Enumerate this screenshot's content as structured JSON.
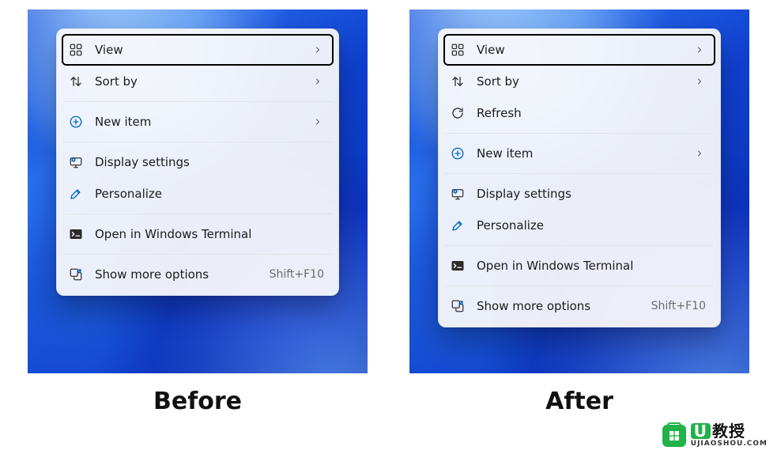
{
  "captions": {
    "before": "Before",
    "after": "After"
  },
  "menu_before": {
    "groups": [
      [
        {
          "id": "view",
          "label": "View",
          "icon": "grid-icon",
          "submenu": true,
          "highlight": true
        },
        {
          "id": "sortby",
          "label": "Sort by",
          "icon": "sort-icon",
          "submenu": true
        }
      ],
      [
        {
          "id": "newitem",
          "label": "New item",
          "icon": "plus-circle-icon",
          "submenu": true
        }
      ],
      [
        {
          "id": "display",
          "label": "Display settings",
          "icon": "monitor-gear-icon"
        },
        {
          "id": "personal",
          "label": "Personalize",
          "icon": "brush-icon"
        }
      ],
      [
        {
          "id": "terminal",
          "label": "Open in Windows Terminal",
          "icon": "terminal-icon"
        }
      ],
      [
        {
          "id": "more",
          "label": "Show more options",
          "icon": "more-icon",
          "accel": "Shift+F10"
        }
      ]
    ]
  },
  "menu_after": {
    "groups": [
      [
        {
          "id": "view",
          "label": "View",
          "icon": "grid-icon",
          "submenu": true,
          "highlight": true
        },
        {
          "id": "sortby",
          "label": "Sort by",
          "icon": "sort-icon",
          "submenu": true
        },
        {
          "id": "refresh",
          "label": "Refresh",
          "icon": "refresh-icon"
        }
      ],
      [
        {
          "id": "newitem",
          "label": "New item",
          "icon": "plus-circle-icon",
          "submenu": true
        }
      ],
      [
        {
          "id": "display",
          "label": "Display settings",
          "icon": "monitor-gear-icon"
        },
        {
          "id": "personal",
          "label": "Personalize",
          "icon": "brush-icon"
        }
      ],
      [
        {
          "id": "terminal",
          "label": "Open in Windows Terminal",
          "icon": "terminal-icon"
        }
      ],
      [
        {
          "id": "more",
          "label": "Show more options",
          "icon": "more-icon",
          "accel": "Shift+F10"
        }
      ]
    ]
  },
  "watermark": {
    "main_prefix": "U",
    "main_rest": "教授",
    "sub": "UJIAOSHOU.COM"
  },
  "colors": {
    "accent_blue": "#0067c0",
    "accent_green": "#21b24a"
  }
}
